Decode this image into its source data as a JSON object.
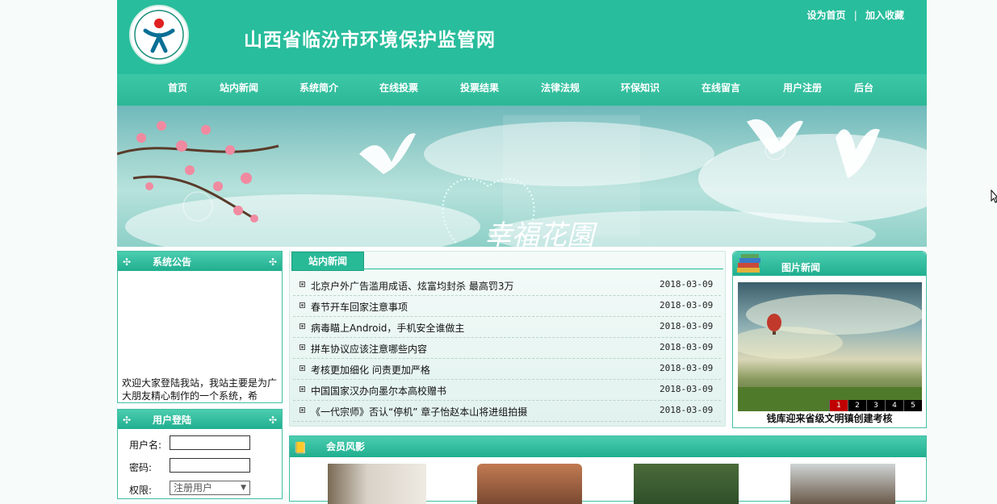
{
  "site": {
    "title": "山西省临汾市环境保护监管网",
    "top_links": [
      "设为首页",
      "加入收藏"
    ],
    "separator": "|"
  },
  "nav": [
    "首页",
    "站内新闻",
    "系统简介",
    "在线投票",
    "投票结果",
    "法律法规",
    "环保知识",
    "在线留言",
    "用户注册",
    "后台"
  ],
  "banner": {
    "text": "幸福花園"
  },
  "notice": {
    "title": "系统公告",
    "text": "欢迎大家登陆我站，我站主要是为广大朋友精心制作的一个系统，希"
  },
  "login": {
    "title": "用户登陆",
    "username_label": "用户名:",
    "password_label": "密码:",
    "role_label": "权限:",
    "role_value": "注册用户"
  },
  "news": {
    "tab": "站内新闻",
    "items": [
      {
        "title": "北京户外广告滥用成语、炫富均封杀 最高罚3万",
        "date": "2018-03-09"
      },
      {
        "title": "春节开车回家注意事项",
        "date": "2018-03-09"
      },
      {
        "title": "病毒瞄上Android，手机安全谁做主",
        "date": "2018-03-09"
      },
      {
        "title": "拼车协议应该注意哪些内容",
        "date": "2018-03-09"
      },
      {
        "title": "考核更加细化 问责更加严格",
        "date": "2018-03-09"
      },
      {
        "title": "中国国家汉办向墨尔本高校赠书",
        "date": "2018-03-09"
      },
      {
        "title": "《一代宗师》否认“停机” 章子怡赵本山将进组拍摄",
        "date": "2018-03-09"
      }
    ]
  },
  "pic_news": {
    "title": "图片新闻",
    "caption": "钱库迎来省级文明镇创建考核",
    "pager": [
      "1",
      "2",
      "3",
      "4",
      "5"
    ],
    "active_page": "1"
  },
  "members": {
    "title": "会员风影"
  },
  "colors": {
    "primary": "#28bd9c",
    "border": "#42bea3",
    "active_page": "#c00000"
  }
}
